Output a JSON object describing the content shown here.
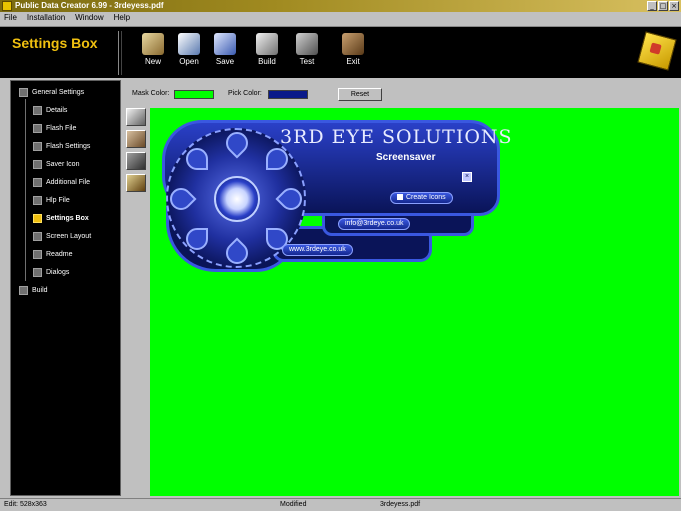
{
  "window": {
    "title": "Public Data Creator 6.99 - 3rdeyess.pdf",
    "controls": [
      "_",
      "□",
      "×"
    ]
  },
  "menu": [
    "File",
    "Installation",
    "Window",
    "Help"
  ],
  "toolbar": {
    "section_title": "Settings Box",
    "buttons": [
      {
        "label": "New",
        "icon": "new-icon"
      },
      {
        "label": "Open",
        "icon": "open-icon"
      },
      {
        "label": "Save",
        "icon": "save-icon"
      },
      {
        "label": "Build",
        "icon": "build-icon"
      },
      {
        "label": "Test",
        "icon": "test-icon"
      },
      {
        "label": "Exit",
        "icon": "exit-icon"
      }
    ],
    "right_icon": "cube-logo-icon"
  },
  "tree": {
    "items": [
      {
        "label": "General Settings",
        "level": 0
      },
      {
        "label": "Details",
        "level": 1
      },
      {
        "label": "Flash File",
        "level": 1
      },
      {
        "label": "Flash Settings",
        "level": 1
      },
      {
        "label": "Saver Icon",
        "level": 1
      },
      {
        "label": "Additional File",
        "level": 1
      },
      {
        "label": "Hlp File",
        "level": 1
      },
      {
        "label": "Settings Box",
        "level": 1,
        "active": true
      },
      {
        "label": "Screen Layout",
        "level": 1
      },
      {
        "label": "Readme",
        "level": 1
      },
      {
        "label": "Dialogs",
        "level": 1
      },
      {
        "label": "Build",
        "level": 0
      }
    ]
  },
  "colors": {
    "mask_label": "Mask Color:",
    "mask_value": "#00ff00",
    "pick_label": "Pick Color:",
    "pick_value": "#0a1a8a",
    "reset_label": "Reset"
  },
  "preview": {
    "title": "3RD EYE SOLUTIONS",
    "subtitle": "Screensaver",
    "close": "×",
    "checkbox_label": "Create Icons",
    "email": "info@3rdeye.co.uk",
    "website": "www.3rdeye.co.uk"
  },
  "status": {
    "position": "Edit: 528x363",
    "state": "Modified",
    "file": "3rdeyess.pdf"
  }
}
